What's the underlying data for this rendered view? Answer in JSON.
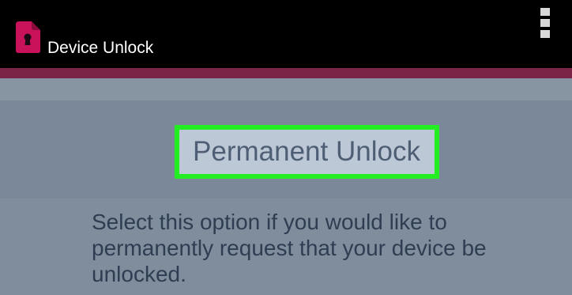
{
  "app_bar": {
    "title": "Device Unlock",
    "icon": "sim-lock-icon",
    "menu_icon": "overflow-menu-icon"
  },
  "colors": {
    "app_bar_bg": "#000000",
    "accent": "#7a2446",
    "icon_pink": "#c8125a",
    "highlight": "#22ee22",
    "background": "#7f8d9c"
  },
  "option": {
    "label": "Permanent Unlock",
    "description": "Select this option if you would like to permanently request that your device be unlocked."
  }
}
